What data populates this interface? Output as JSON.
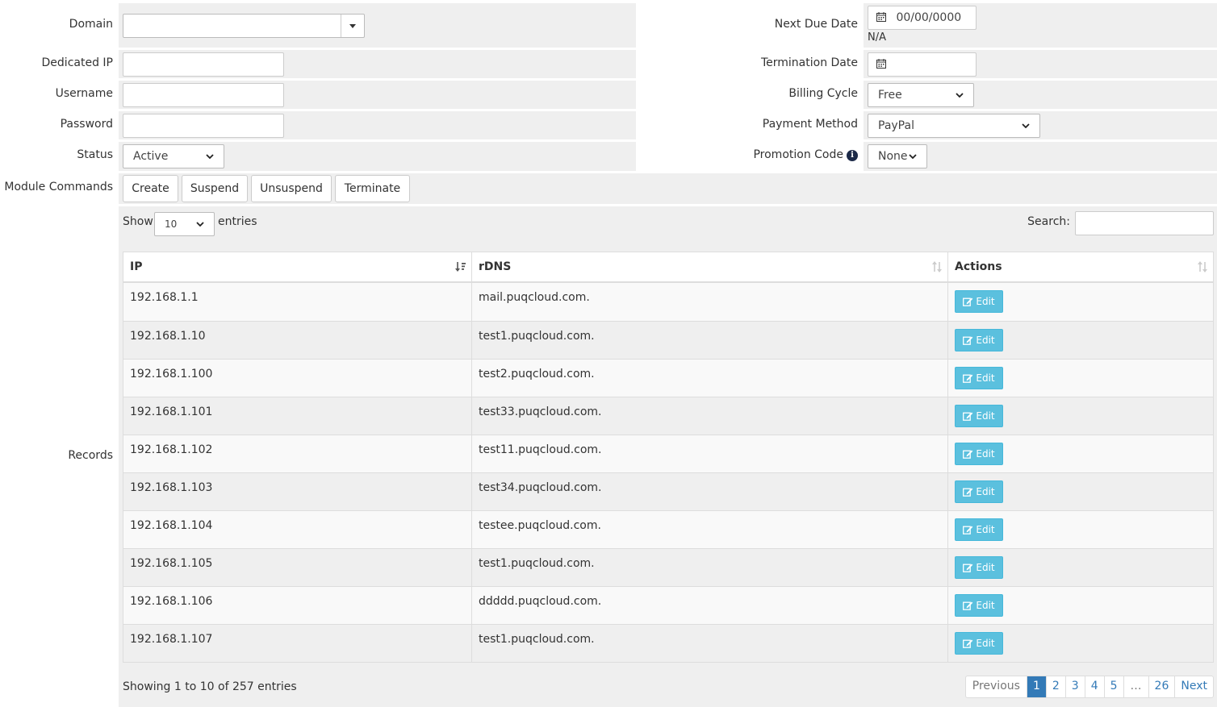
{
  "form": {
    "domain": {
      "label": "Domain",
      "value": ""
    },
    "dedicated_ip": {
      "label": "Dedicated IP",
      "value": ""
    },
    "username": {
      "label": "Username",
      "value": ""
    },
    "password": {
      "label": "Password",
      "value": ""
    },
    "status": {
      "label": "Status",
      "value": "Active"
    },
    "next_due_date": {
      "label": "Next Due Date",
      "value": "00/00/0000",
      "note": "N/A"
    },
    "termination_date": {
      "label": "Termination Date",
      "value": ""
    },
    "billing_cycle": {
      "label": "Billing Cycle",
      "value": "Free"
    },
    "payment_method": {
      "label": "Payment Method",
      "value": "PayPal"
    },
    "promotion_code": {
      "label": "Promotion Code",
      "value": "None"
    }
  },
  "module_commands": {
    "label": "Module Commands",
    "buttons": [
      "Create",
      "Suspend",
      "Unsuspend",
      "Terminate"
    ]
  },
  "records": {
    "label": "Records",
    "show_label": "Show",
    "page_size": "10",
    "entries_label": "entries",
    "search_label": "Search:",
    "search_value": "",
    "columns": [
      "IP",
      "rDNS",
      "Actions"
    ],
    "edit_label": "Edit",
    "rows": [
      {
        "ip": "192.168.1.1",
        "rdns": "mail.puqcloud.com."
      },
      {
        "ip": "192.168.1.10",
        "rdns": "test1.puqcloud.com."
      },
      {
        "ip": "192.168.1.100",
        "rdns": "test2.puqcloud.com."
      },
      {
        "ip": "192.168.1.101",
        "rdns": "test33.puqcloud.com."
      },
      {
        "ip": "192.168.1.102",
        "rdns": "test11.puqcloud.com."
      },
      {
        "ip": "192.168.1.103",
        "rdns": "test34.puqcloud.com."
      },
      {
        "ip": "192.168.1.104",
        "rdns": "testee.puqcloud.com."
      },
      {
        "ip": "192.168.1.105",
        "rdns": "test1.puqcloud.com."
      },
      {
        "ip": "192.168.1.106",
        "rdns": "ddddd.puqcloud.com."
      },
      {
        "ip": "192.168.1.107",
        "rdns": "test1.puqcloud.com."
      }
    ],
    "info": "Showing 1 to 10 of 257 entries",
    "pagination": {
      "previous": "Previous",
      "pages": [
        "1",
        "2",
        "3",
        "4",
        "5",
        "…",
        "26"
      ],
      "active": "1",
      "next": "Next"
    }
  },
  "colors": {
    "cell_bg": "#efefef",
    "edit_button": "#5bc0de",
    "pager_active": "#337ab7"
  }
}
